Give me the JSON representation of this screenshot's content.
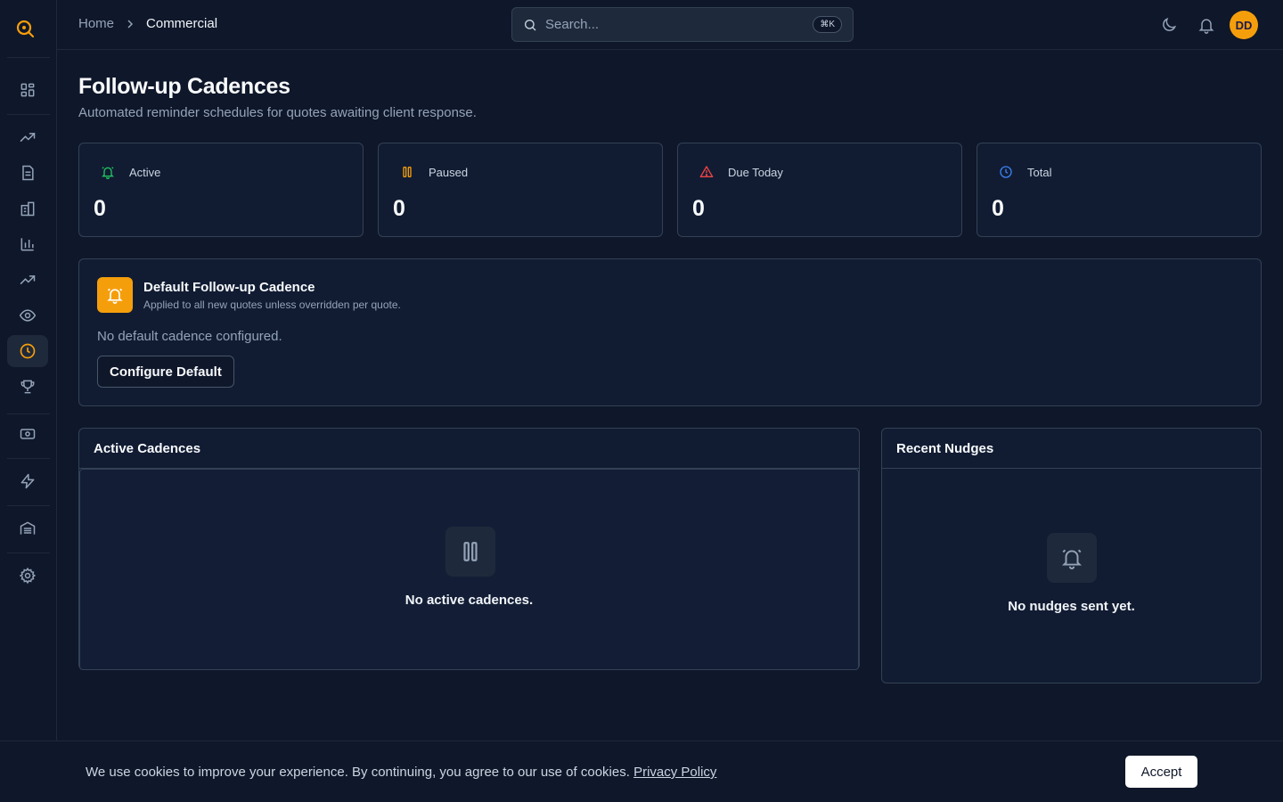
{
  "breadcrumb": {
    "home": "Home",
    "current": "Commercial"
  },
  "search": {
    "placeholder": "Search...",
    "shortcut": "⌘K"
  },
  "user": {
    "initials": "DD"
  },
  "page": {
    "title": "Follow-up Cadences",
    "subtitle": "Automated reminder schedules for quotes awaiting client response."
  },
  "stats": [
    {
      "label": "Active",
      "value": "0",
      "icon": "bell-ring-icon",
      "color": "#22c55e"
    },
    {
      "label": "Paused",
      "value": "0",
      "icon": "pause-icon",
      "color": "#f59e0b"
    },
    {
      "label": "Due Today",
      "value": "0",
      "icon": "alert-triangle-icon",
      "color": "#ef4444"
    },
    {
      "label": "Total",
      "value": "0",
      "icon": "clock-icon",
      "color": "#3b82f6"
    }
  ],
  "default_cadence": {
    "title": "Default Follow-up Cadence",
    "description": "Applied to all new quotes unless overridden per quote.",
    "empty": "No default cadence configured.",
    "button": "Configure Default"
  },
  "active_cadences": {
    "title": "Active Cadences",
    "empty": "No active cadences."
  },
  "recent_nudges": {
    "title": "Recent Nudges",
    "empty": "No nudges sent yet."
  },
  "cookie": {
    "message": "We use cookies to improve your experience. By continuing, you agree to our use of cookies.",
    "link": "Privacy Policy",
    "accept": "Accept"
  },
  "colors": {
    "accent": "#f59e0b",
    "background": "#0f172a",
    "card": "#111c33",
    "border": "#334155"
  }
}
